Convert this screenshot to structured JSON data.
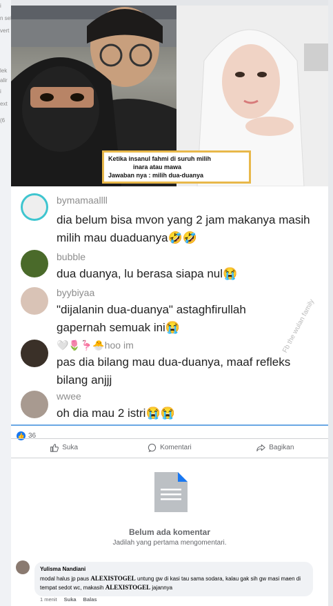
{
  "background_fragments": [
    "i",
    "n sel",
    "vert",
    "lek",
    "alir",
    "i",
    "ext",
    "(6"
  ],
  "post": {
    "caption_lines": [
      "Ketika insanul fahmi di suruh milih",
      "inara atau mawa",
      "Jawaban nya : milih dua-duanya"
    ],
    "image_comments": [
      {
        "user": "bymamaallll",
        "text": "dia belum bisa mvon yang 2 jam makanya masih milih mau duaduanya🤣🤣"
      },
      {
        "user": "bubble",
        "text": "dua duanya, lu berasa siapa nul😭"
      },
      {
        "user": "byybiyaa",
        "text": "\"dijalanin dua-duanya\" astaghfirullah gapernah semuak ini😭"
      },
      {
        "user": "🤍🌷🦩🐣hoo im",
        "text": "pas dia bilang mau dua-duanya, maaf refleks bilang anjjj"
      },
      {
        "user": "wwee",
        "text": "oh dia mau 2 istri😭😭"
      }
    ],
    "watermark": "Fb the wulan family"
  },
  "reactions": {
    "count": "36"
  },
  "actions": {
    "like": "Suka",
    "comment": "Komentari",
    "share": "Bagikan"
  },
  "empty_state": {
    "title": "Belum ada komentar",
    "subtitle": "Jadilah yang pertama mengomentari."
  },
  "comment": {
    "name": "Yulisma Nandiani",
    "body_part1": "modal halus jp paus ",
    "brand1": "ALEXISTOGEL",
    "body_part2": " untung gw di kasi tau sama sodara, kalau gak sih gw masi maen di tempat sedot wc, makasih ",
    "brand2": "ALEXISTOGEL",
    "body_part3": " jajannya",
    "time": "1 menit",
    "like": "Suka",
    "reply": "Balas"
  },
  "colors": {
    "accent": "#1877f2",
    "caption_border": "#e8b84a",
    "divider": "#6aa7e4"
  }
}
